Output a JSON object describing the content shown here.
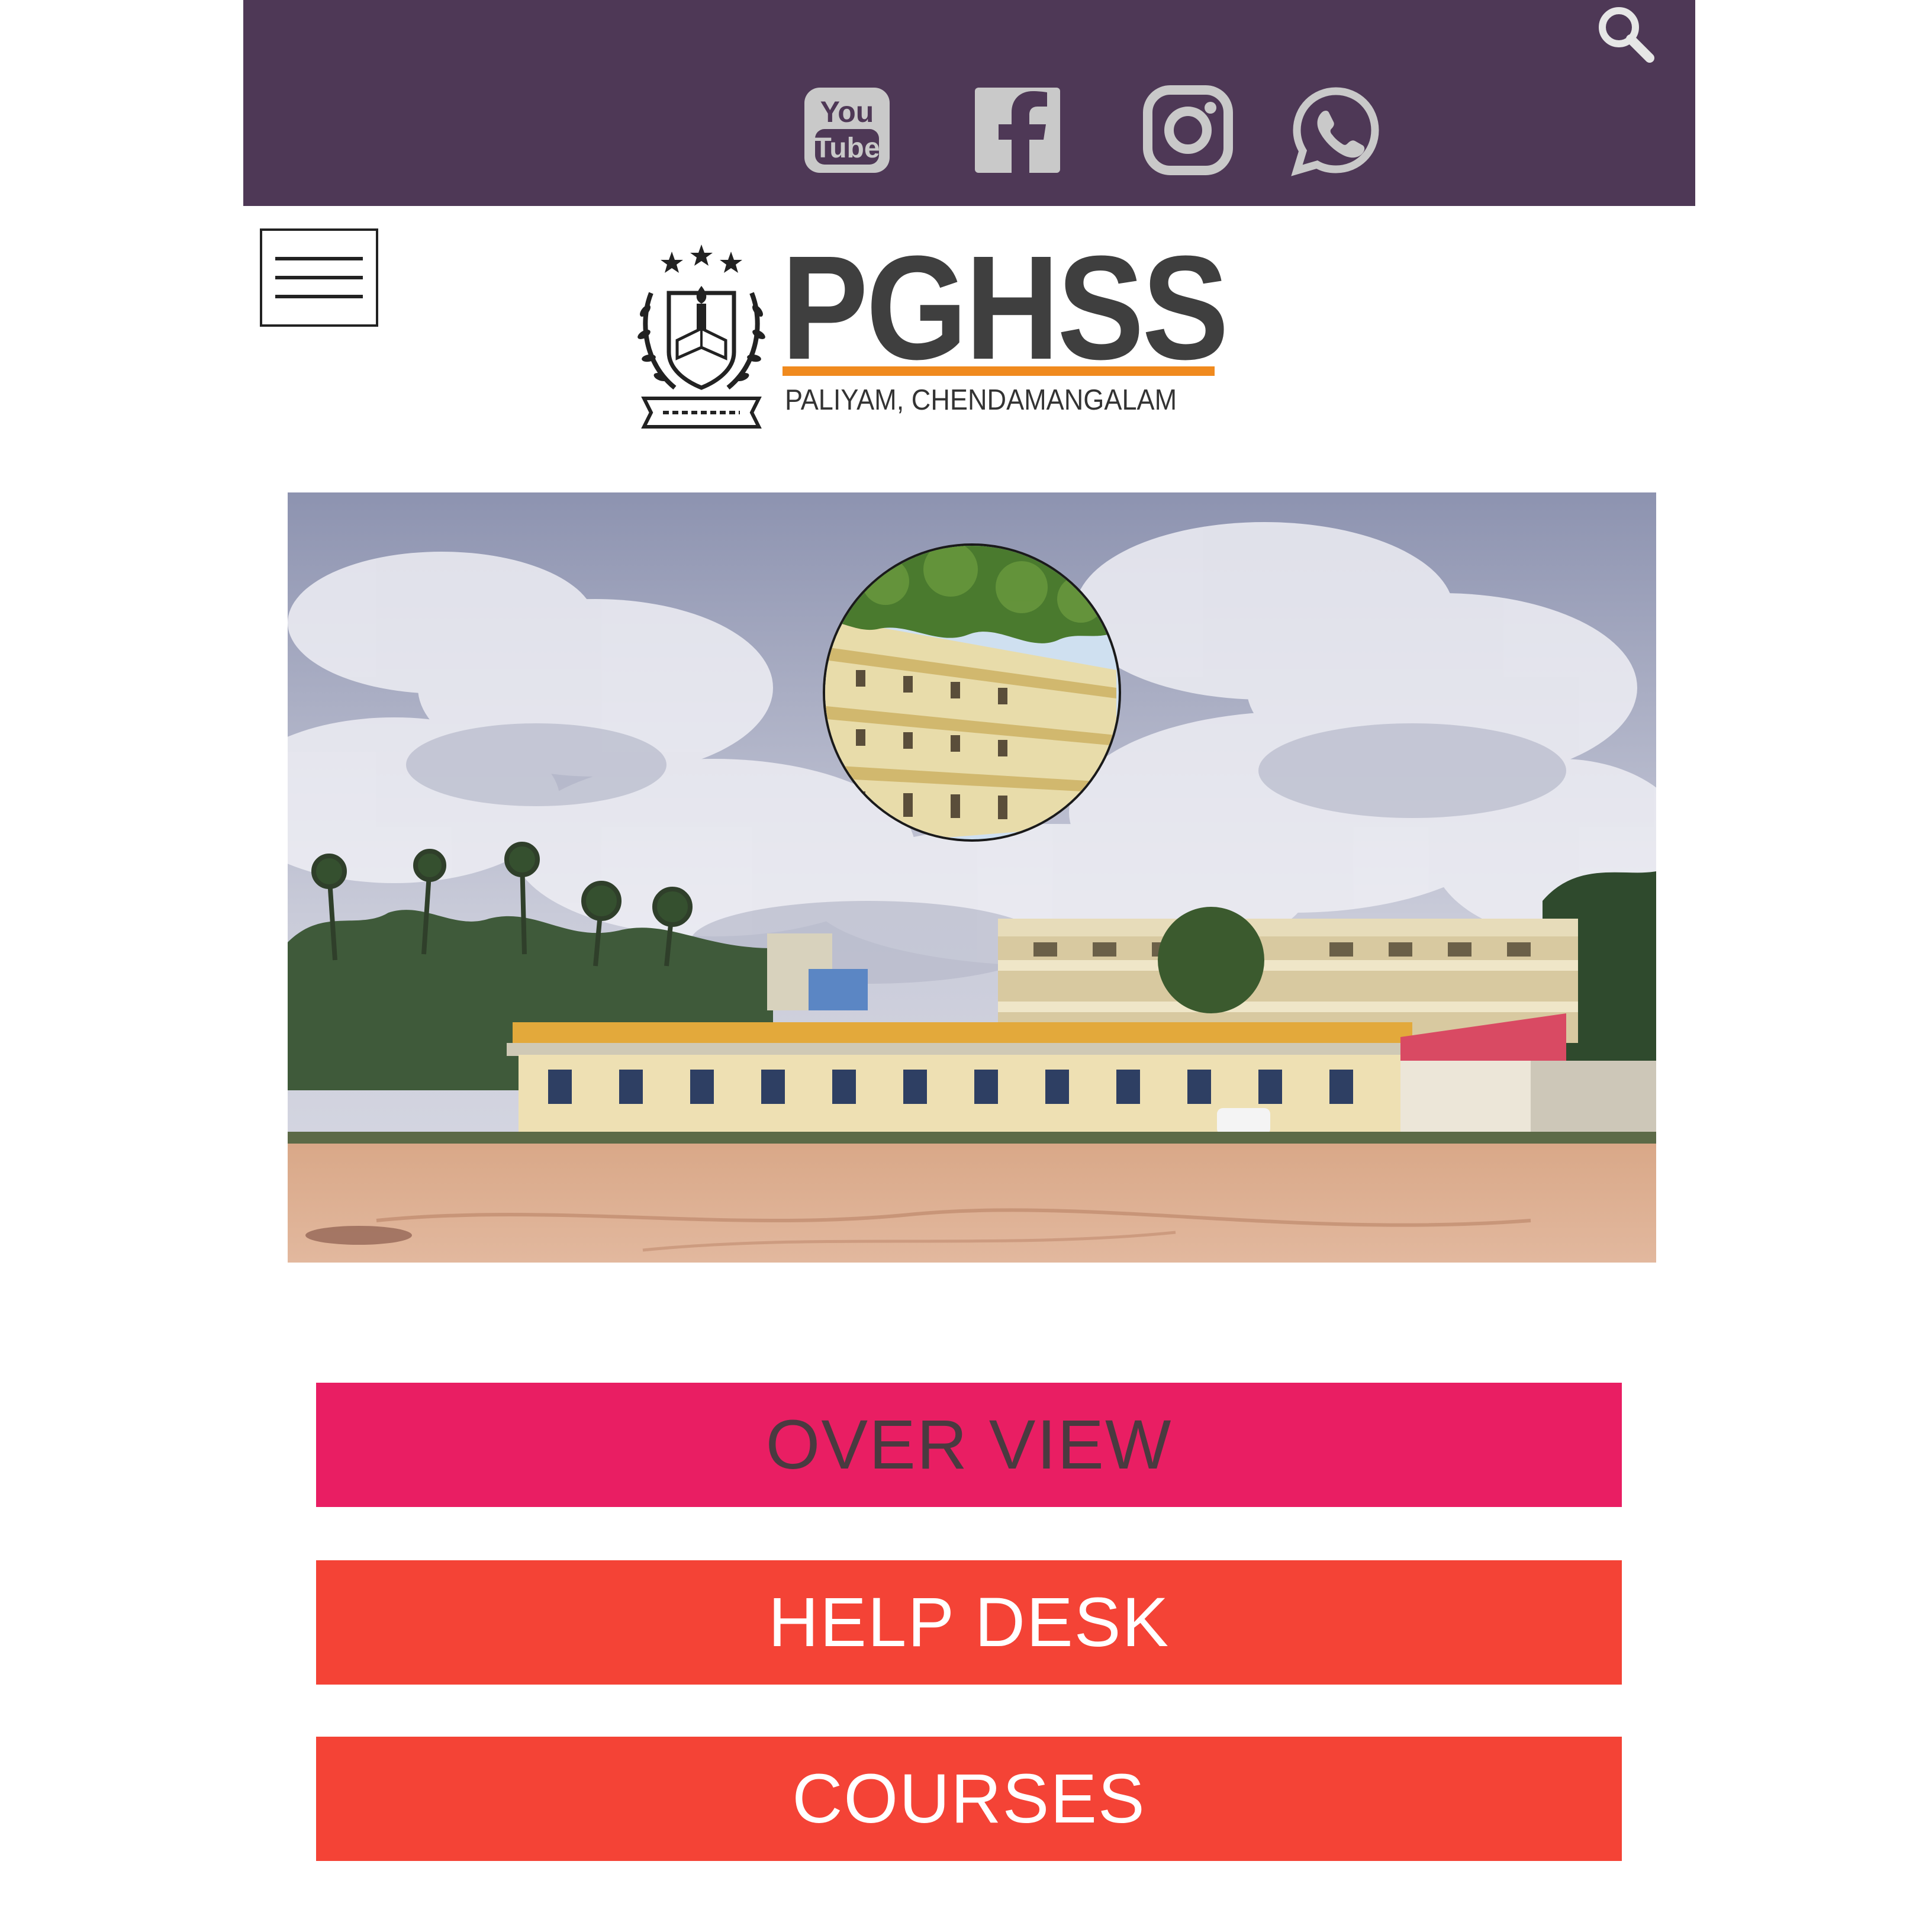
{
  "colors": {
    "topbar_bg": "#4e3856",
    "social_icon": "#c9c9c9",
    "overview_bg": "#e91e63",
    "overview_text": "#4a3a40",
    "helpdesk_bg": "#f44336",
    "courses_bg": "#f44336",
    "cta_text_light": "#ffffff",
    "logo_accent": "#f08a1e"
  },
  "topbar": {
    "search_icon": "search-icon",
    "social": [
      {
        "name": "youtube-icon",
        "text_top": "You",
        "text_bottom": "Tube"
      },
      {
        "name": "facebook-icon"
      },
      {
        "name": "instagram-icon"
      },
      {
        "name": "whatsapp-icon"
      }
    ]
  },
  "header": {
    "menu_icon": "hamburger-menu-icon",
    "logo_title": "PGHSS",
    "logo_subtitle": "PALIYAM, CHENDAMANGALAM",
    "emblem_icon": "school-emblem-icon"
  },
  "hero": {
    "description": "school-campus-photo",
    "inset_icon": "building-inset-photo"
  },
  "nav_buttons": {
    "overview": "OVER VIEW",
    "helpdesk": "HELP DESK",
    "courses": "COURSES"
  }
}
